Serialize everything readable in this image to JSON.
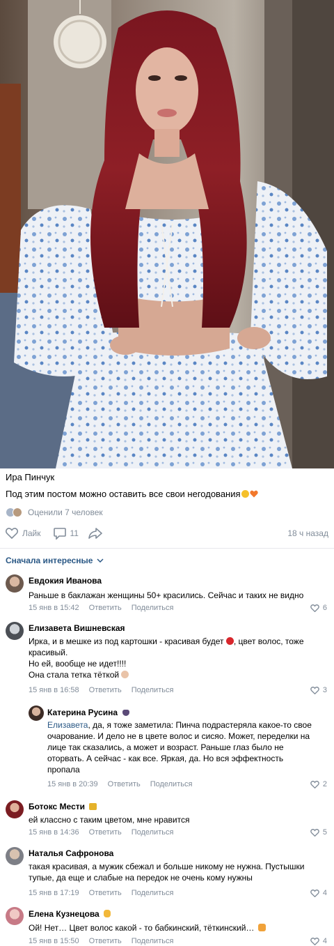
{
  "post": {
    "author": "Ира Пинчук",
    "text": "Под этим постом можно оставить все свои негодования",
    "rated_text": "Оценили 7 человек",
    "like_label": "Лайк",
    "comments_count": "11",
    "time_ago": "18 ч назад"
  },
  "sort_label": "Сначала интересные",
  "comments": [
    {
      "name": "Евдокия Иванова",
      "text": "Раньше в баклажан женщины 50+ красились. Сейчас и таких не видно",
      "date": "15 янв в 15:42",
      "reply": "Ответить",
      "share": "Поделиться",
      "likes": "6"
    },
    {
      "name": "Елизавета Вишневская",
      "lines": [
        "Ирка, и в мешке из под картошки - красивая будет",
        ", цвет волос, тоже",
        "красивый.",
        "Но ей, вообще не идет!!!!",
        "Она стала тетка тёткой"
      ],
      "date": "15 янв в 16:58",
      "reply": "Ответить",
      "share": "Поделиться",
      "likes": "3"
    },
    {
      "name": "Катерина Русина",
      "reply_to": "Елизавета",
      "lines": [
        ", да, я тоже заметила: Пинча подрастеряла какое-то свое",
        "очарование. И дело не в цвете волос и сисяо. Может, переделки на",
        "лице так сказались, а может и возраст. Раньше глаз было не",
        "оторвать. А сейчас - как все. Яркая, да. Но вся эффектность",
        "пропала"
      ],
      "date": "15 янв в 20:39",
      "reply": "Ответить",
      "share": "Поделиться",
      "likes": "2"
    },
    {
      "name": "Ботокс Мести",
      "text": "ей классно с таким цветом, мне нравится",
      "date": "15 янв в 14:36",
      "reply": "Ответить",
      "share": "Поделиться",
      "likes": "5"
    },
    {
      "name": "Наталья Сафронова",
      "lines": [
        "такая красивая, а мужик сбежал и больше никому не нужна. Пустышки",
        "тупые, да еще и слабые на передок не очень кому нужны"
      ],
      "date": "15 янв в 17:19",
      "reply": "Ответить",
      "share": "Поделиться",
      "likes": "4"
    },
    {
      "name": "Елена Кузнецова",
      "text": "Ой! Нет… Цвет волос какой - то бабкинский, тёткинский…",
      "date": "15 янв в 15:50",
      "reply": "Ответить",
      "share": "Поделиться",
      "likes": "4"
    }
  ],
  "colors": {
    "link": "#2a5885",
    "muted": "#818c99",
    "divider": "#e7e8ec",
    "hair": "#8e1f26"
  },
  "icons": [
    "heart-icon",
    "comment-icon",
    "share-icon",
    "chevron-down-icon",
    "laughing-emoji-icon",
    "orange-heart-emoji-icon"
  ]
}
